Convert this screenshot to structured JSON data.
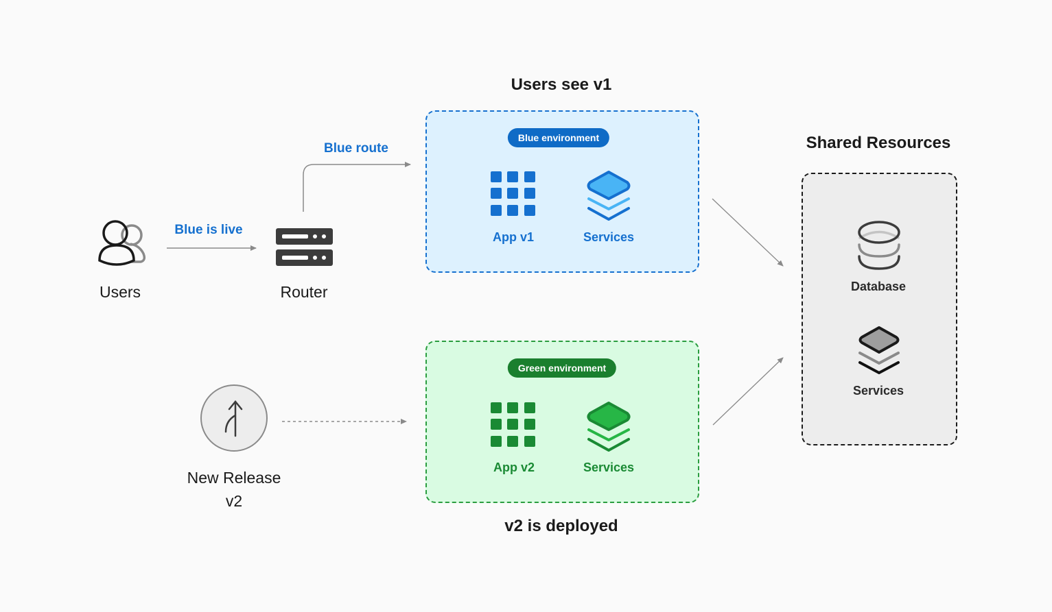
{
  "titles": {
    "top": "Users see v1",
    "bottom": "v2 is deployed",
    "shared": "Shared Resources"
  },
  "nodes": {
    "users": "Users",
    "router": "Router",
    "release_line1": "New Release",
    "release_line2": "v2"
  },
  "edges": {
    "blue_is_live": "Blue is live",
    "blue_route": "Blue route"
  },
  "blue_env": {
    "badge": "Blue environment",
    "app": "App v1",
    "services": "Services"
  },
  "green_env": {
    "badge": "Green environment",
    "app": "App v2",
    "services": "Services"
  },
  "shared": {
    "database": "Database",
    "services": "Services"
  },
  "colors": {
    "background": "#fafafa",
    "blue_accent": "#1570cf",
    "blue_fill": "#ddf1fe",
    "green_accent": "#1a8a34",
    "green_fill": "#d9fbe2",
    "shared_fill": "#ededed",
    "arrow": "#8a8a8a"
  }
}
